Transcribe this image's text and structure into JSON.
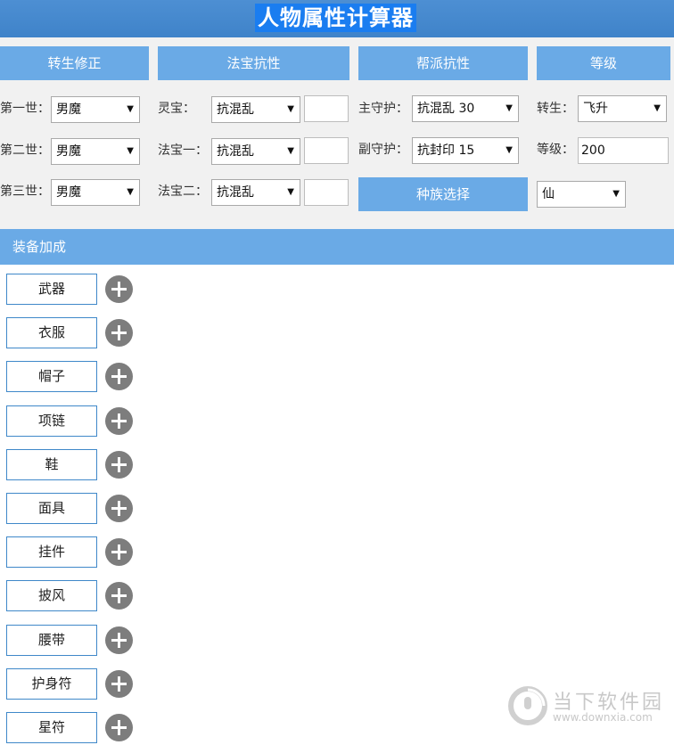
{
  "title": "人物属性计算器",
  "headers": {
    "rebirth": "转生修正",
    "treasure": "法宝抗性",
    "faction": "帮派抗性",
    "level": "等级"
  },
  "rebirth": {
    "rows": [
      {
        "label": "第一世：",
        "value": "男魔"
      },
      {
        "label": "第二世：",
        "value": "男魔"
      },
      {
        "label": "第三世：",
        "value": "男魔"
      }
    ]
  },
  "treasure": {
    "rows": [
      {
        "label": "灵宝：",
        "value": "抗混乱",
        "extra": ""
      },
      {
        "label": "法宝一：",
        "value": "抗混乱",
        "extra": ""
      },
      {
        "label": "法宝二：",
        "value": "抗混乱",
        "extra": ""
      }
    ]
  },
  "faction": {
    "main_label": "主守护：",
    "main_value": "抗混乱 30",
    "sub_label": "副守护：",
    "sub_value": "抗封印 15",
    "race_button": "种族选择"
  },
  "level": {
    "rebirth_label": "转生：",
    "rebirth_value": "飞升",
    "level_label": "等级：",
    "level_value": "200",
    "race_value": "仙"
  },
  "equipment": {
    "section_title": "装备加成",
    "items": [
      "武器",
      "衣服",
      "帽子",
      "项链",
      "鞋",
      "面具",
      "挂件",
      "披风",
      "腰带",
      "护身符",
      "星符"
    ]
  },
  "watermark": {
    "name": "当下软件园",
    "url": "www.downxia.com"
  }
}
